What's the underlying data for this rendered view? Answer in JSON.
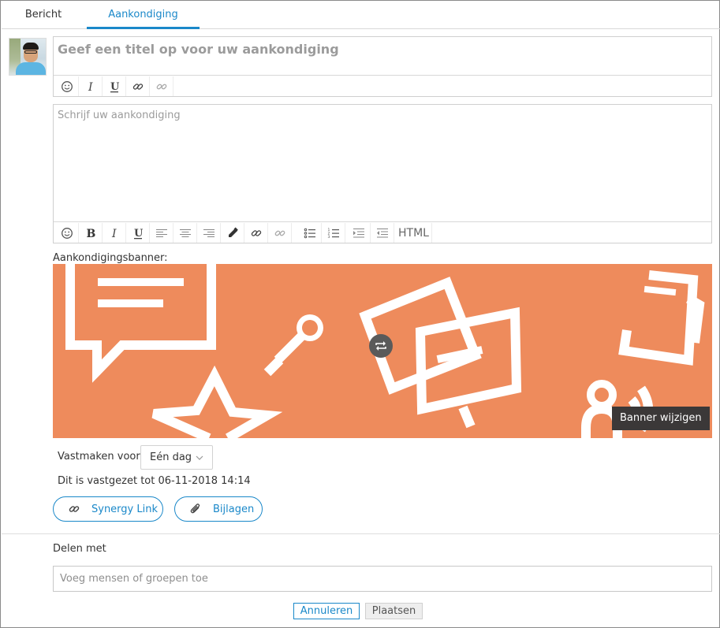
{
  "tabs": [
    {
      "label": "Bericht",
      "active": false
    },
    {
      "label": "Aankondiging",
      "active": true
    }
  ],
  "title_field": {
    "placeholder": "Geef een titel op voor uw aankondiging"
  },
  "title_toolbar": [
    "smiley-icon",
    "italic-icon",
    "underline-icon",
    "link-icon",
    "unlink-icon"
  ],
  "body_field": {
    "placeholder": "Schrijf uw aankondiging"
  },
  "body_toolbar": {
    "icons": [
      "smiley-icon",
      "bold-icon",
      "italic-icon",
      "underline-icon",
      "align-left-icon",
      "align-center-icon",
      "align-right-icon",
      "color-picker-icon",
      "link-icon",
      "unlink-icon",
      "bullet-list-icon",
      "numbered-list-icon",
      "indent-icon",
      "outdent-icon"
    ],
    "html_label": "HTML"
  },
  "banner": {
    "label": "Aankondigingsbanner:",
    "background": "#ee8b5c",
    "tooltip": "Banner wijzigen"
  },
  "pin": {
    "label": "Vastmaken voor",
    "selected": "Eén dag",
    "note": "Dit is vastgezet tot 06-11-2018 14:14"
  },
  "actions": {
    "synergy_link": "Synergy Link",
    "attachments": "Bijlagen"
  },
  "share": {
    "label": "Delen met",
    "placeholder": "Voeg mensen of groepen toe"
  },
  "buttons": {
    "cancel": "Annuleren",
    "post": "Plaatsen"
  },
  "colors": {
    "accent": "#1a88c9"
  }
}
